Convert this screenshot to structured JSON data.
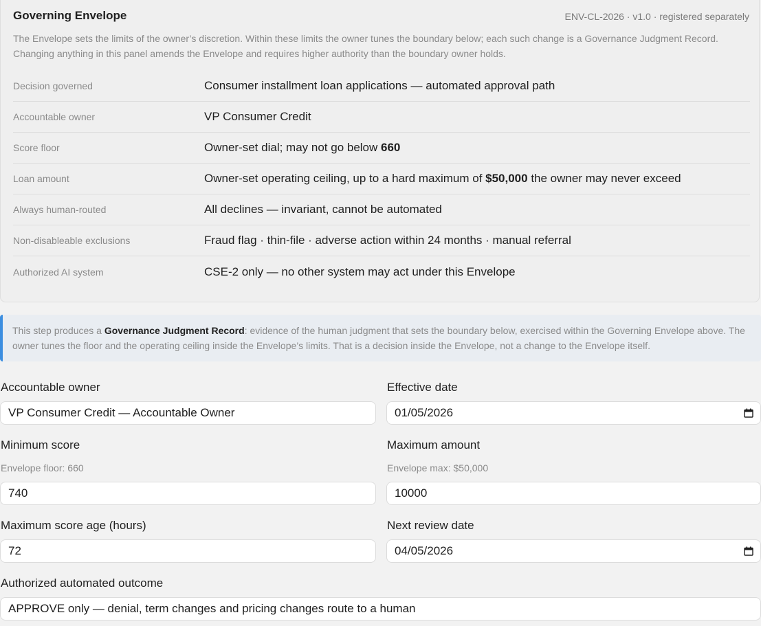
{
  "envelope": {
    "title": "Governing Envelope",
    "id_line": "ENV-CL-2026 · v1.0 · registered separately",
    "description": "The Envelope sets the limits of the owner’s discretion. Within these limits the owner tunes the boundary below; each such change is a Governance Judgment Record. Changing anything in this panel amends the Envelope and requires higher authority than the boundary owner holds.",
    "rows": [
      {
        "label": "Decision governed",
        "value": "Consumer installment loan applications — automated approval path"
      },
      {
        "label": "Accountable owner",
        "value": "VP Consumer Credit"
      },
      {
        "label": "Score floor",
        "value_pre": "Owner-set dial; may not go below ",
        "value_bold": "660",
        "value_post": ""
      },
      {
        "label": "Loan amount",
        "value_pre": "Owner-set operating ceiling, up to a hard maximum of ",
        "value_bold": "$50,000",
        "value_post": " the owner may never exceed"
      },
      {
        "label": "Always human-routed",
        "value": "All declines — invariant, cannot be automated"
      },
      {
        "label": "Non-disableable exclusions",
        "value": "Fraud flag · thin-file · adverse action within 24 months · manual referral"
      },
      {
        "label": "Authorized AI system",
        "value": "CSE-2 only — no other system may act under this Envelope"
      }
    ]
  },
  "callout": {
    "pre": "This step produces a ",
    "bold": "Governance Judgment Record",
    "post": ": evidence of the human judgment that sets the boundary below, exercised within the Governing Envelope above. The owner tunes the floor and the operating ceiling inside the Envelope’s limits. That is a decision inside the Envelope, not a change to the Envelope itself."
  },
  "form": {
    "owner": {
      "label": "Accountable owner",
      "value": "VP Consumer Credit — Accountable Owner"
    },
    "effective_date": {
      "label": "Effective date",
      "value": "01/05/2026"
    },
    "min_score": {
      "label": "Minimum score",
      "hint": "Envelope floor: 660",
      "value": "740"
    },
    "max_amount": {
      "label": "Maximum amount",
      "hint": "Envelope max: $50,000",
      "value": "10000"
    },
    "max_score_age": {
      "label": "Maximum score age (hours)",
      "value": "72"
    },
    "next_review": {
      "label": "Next review date",
      "value": "04/05/2026"
    },
    "outcome": {
      "label": "Authorized automated outcome",
      "value": "APPROVE only — denial, term changes and pricing changes route to a human"
    }
  },
  "icons": {
    "date_picker": "calendar-icon"
  },
  "colors": {
    "accent": "#3c8ee0",
    "callout_bg": "#e9edf2",
    "page_bg": "#f2f2f2"
  }
}
